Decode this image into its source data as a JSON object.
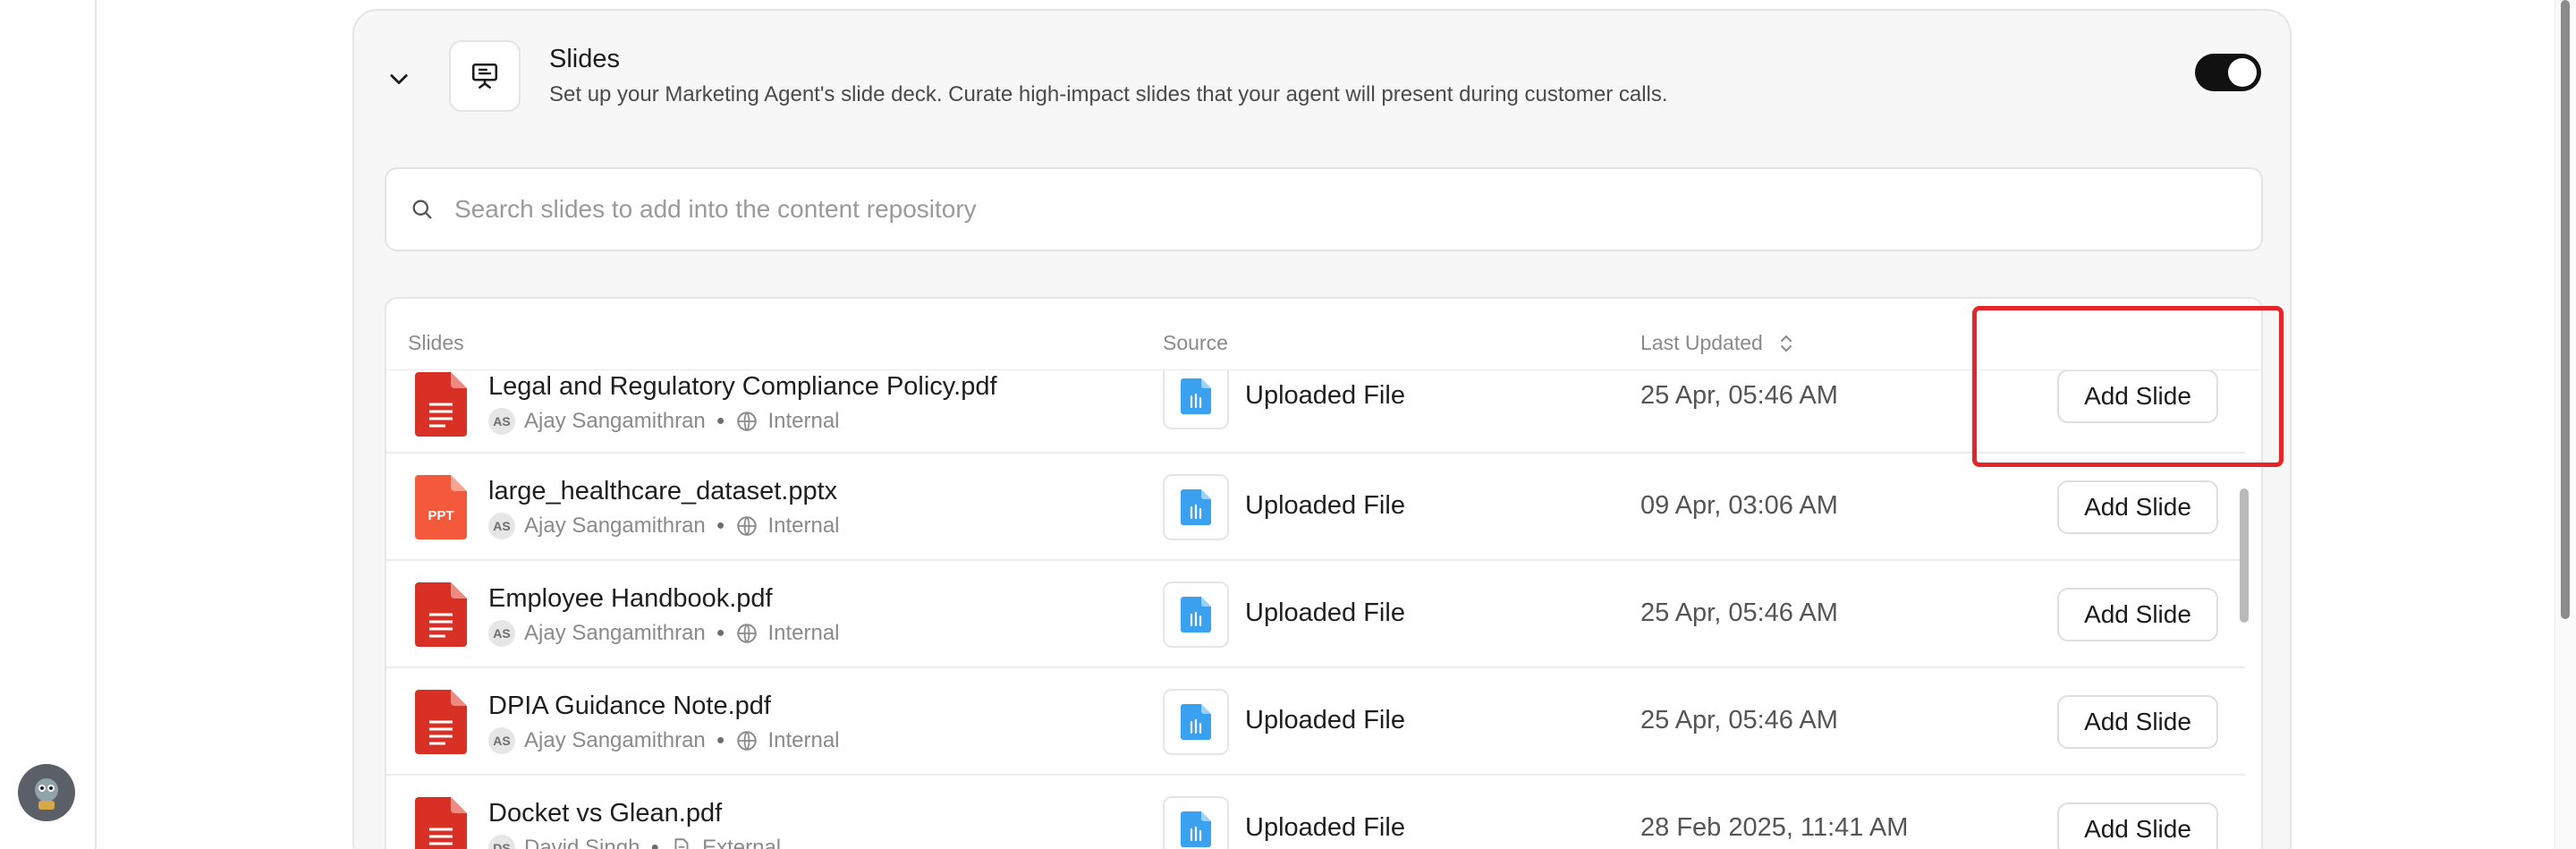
{
  "section": {
    "title": "Slides",
    "description": "Set up your Marketing Agent's slide deck. Curate high-impact slides that your agent will present during customer calls.",
    "enabled": true
  },
  "search": {
    "placeholder": "Search slides to add into the content repository"
  },
  "table": {
    "headers": {
      "slides": "Slides",
      "source": "Source",
      "last_updated": "Last Updated"
    },
    "rows": [
      {
        "name": "Legal and Regulatory Compliance Policy.pdf",
        "type": "pdf",
        "initials": "AS",
        "owner": "Ajay Sangamithran",
        "visibility": "Internal",
        "visibility_icon": "globe-icon",
        "source": "Uploaded File",
        "updated": "25 Apr, 05:46 AM",
        "action": "Add Slide"
      },
      {
        "name": "large_healthcare_dataset.pptx",
        "type": "ppt",
        "type_label": "PPT",
        "initials": "AS",
        "owner": "Ajay Sangamithran",
        "visibility": "Internal",
        "visibility_icon": "globe-icon",
        "source": "Uploaded File",
        "updated": "09 Apr, 03:06 AM",
        "action": "Add Slide"
      },
      {
        "name": "Employee Handbook.pdf",
        "type": "pdf",
        "initials": "AS",
        "owner": "Ajay Sangamithran",
        "visibility": "Internal",
        "visibility_icon": "globe-icon",
        "source": "Uploaded File",
        "updated": "25 Apr, 05:46 AM",
        "action": "Add Slide"
      },
      {
        "name": "DPIA Guidance Note.pdf",
        "type": "pdf",
        "initials": "AS",
        "owner": "Ajay Sangamithran",
        "visibility": "Internal",
        "visibility_icon": "globe-icon",
        "source": "Uploaded File",
        "updated": "25 Apr, 05:46 AM",
        "action": "Add Slide"
      },
      {
        "name": "Docket vs Glean.pdf",
        "type": "pdf",
        "initials": "DS",
        "owner": "David Singh",
        "visibility": "External",
        "visibility_icon": "document-icon",
        "source": "Uploaded File",
        "updated": "28 Feb 2025, 11:41 AM",
        "action": "Add Slide"
      }
    ]
  },
  "colors": {
    "pdf_red": "#d93025",
    "ppt_orange": "#f4593b",
    "uploaded_blue": "#3aa0f0",
    "toggle_on": "#111111",
    "highlight": "#e5252a"
  }
}
